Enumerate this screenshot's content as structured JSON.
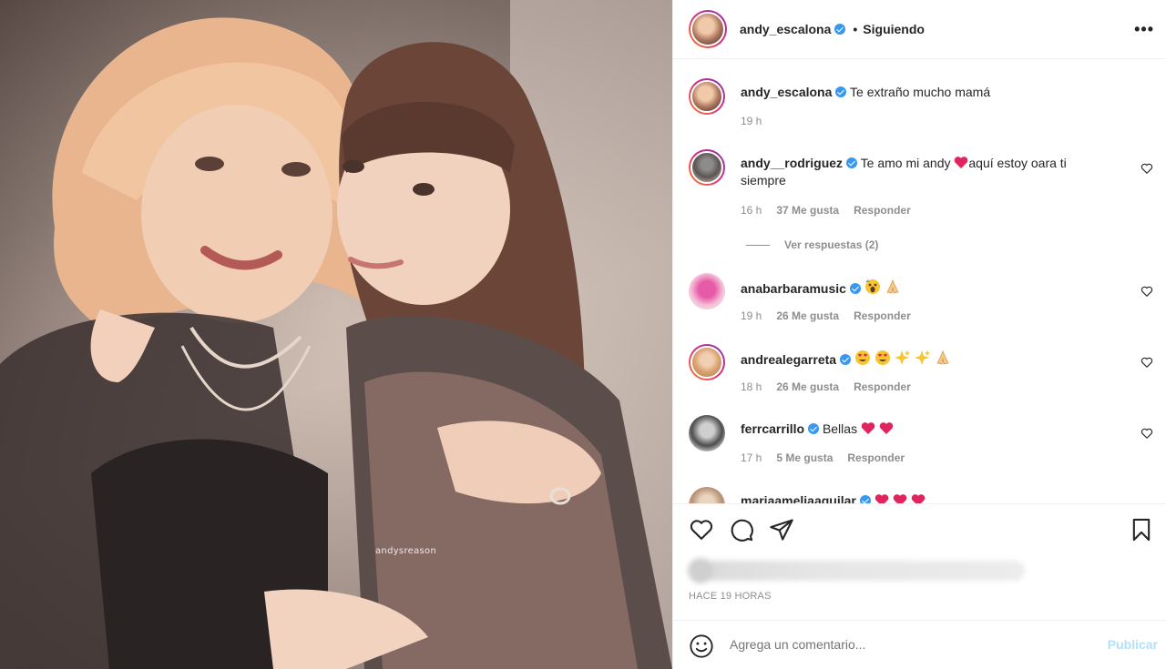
{
  "post": {
    "watermark": "andysreason"
  },
  "header": {
    "username": "andy_escalona",
    "separator": "•",
    "follow_status": "Siguiendo",
    "more_icon": "more-horizontal-icon"
  },
  "comments": [
    {
      "user": "andy_escalona",
      "verified": true,
      "text": "Te extraño mucho mamá",
      "time": "19 h",
      "likes": "",
      "reply": ""
    },
    {
      "user": "andy__rodriguez",
      "verified": true,
      "text_before": "Te amo mi andy",
      "text_after": "aquí estoy oara ti siempre",
      "time": "16 h",
      "likes": "37 Me gusta",
      "reply": "Responder"
    },
    {
      "user": "anabarbaramusic",
      "verified": true,
      "text": "",
      "time": "19 h",
      "likes": "26 Me gusta",
      "reply": "Responder"
    },
    {
      "user": "andrealegarreta",
      "verified": true,
      "text": "",
      "time": "18 h",
      "likes": "26 Me gusta",
      "reply": "Responder"
    },
    {
      "user": "ferrcarrillo",
      "verified": true,
      "text": "Bellas",
      "time": "17 h",
      "likes": "5 Me gusta",
      "reply": "Responder"
    },
    {
      "user": "mariaameliaaguilar",
      "verified": true,
      "text": ""
    }
  ],
  "view_replies": "Ver respuestas (2)",
  "footer": {
    "timestamp": "HACE 19 HORAS",
    "comment_placeholder": "Agrega un comentario...",
    "publish_label": "Publicar"
  },
  "colors": {
    "verified": "#3897f0",
    "muted_text": "#8e8e8e",
    "publish_disabled": "#b2dffc",
    "emoji_heart": "#e0245e"
  }
}
